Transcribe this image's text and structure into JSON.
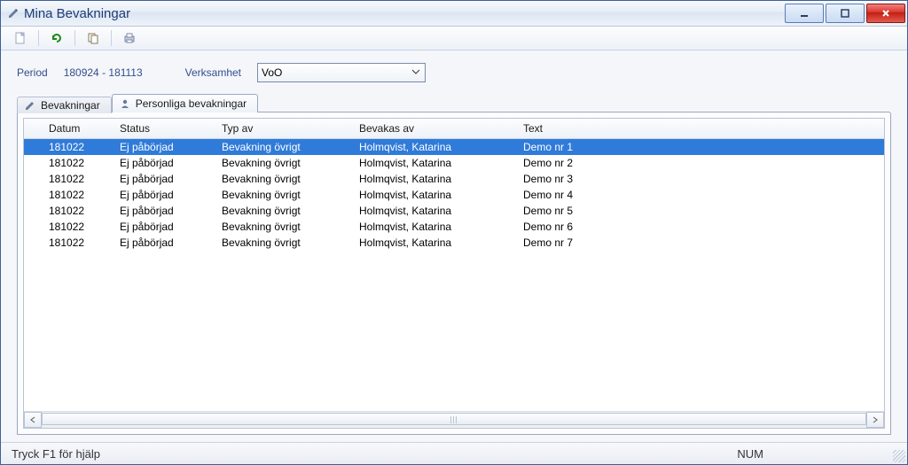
{
  "window": {
    "title": "Mina Bevakningar"
  },
  "filters": {
    "period_label": "Period",
    "period_value": "180924 - 181113",
    "verksamhet_label": "Verksamhet",
    "verksamhet_value": "VoO"
  },
  "tabs": {
    "bevakningar": "Bevakningar",
    "personliga": "Personliga bevakningar"
  },
  "columns": {
    "datum": "Datum",
    "status": "Status",
    "typ": "Typ av",
    "bevakas": "Bevakas av",
    "text": "Text"
  },
  "rows": [
    {
      "datum": "181022",
      "status": "Ej påbörjad",
      "typ": "Bevakning övrigt",
      "bevakas": "Holmqvist, Katarina",
      "text": "Demo nr 1",
      "selected": true
    },
    {
      "datum": "181022",
      "status": "Ej påbörjad",
      "typ": "Bevakning övrigt",
      "bevakas": "Holmqvist, Katarina",
      "text": "Demo nr 2",
      "selected": false
    },
    {
      "datum": "181022",
      "status": "Ej påbörjad",
      "typ": "Bevakning övrigt",
      "bevakas": "Holmqvist, Katarina",
      "text": "Demo nr 3",
      "selected": false
    },
    {
      "datum": "181022",
      "status": "Ej påbörjad",
      "typ": "Bevakning övrigt",
      "bevakas": "Holmqvist, Katarina",
      "text": "Demo nr 4",
      "selected": false
    },
    {
      "datum": "181022",
      "status": "Ej påbörjad",
      "typ": "Bevakning övrigt",
      "bevakas": "Holmqvist, Katarina",
      "text": "Demo nr 5",
      "selected": false
    },
    {
      "datum": "181022",
      "status": "Ej påbörjad",
      "typ": "Bevakning övrigt",
      "bevakas": "Holmqvist, Katarina",
      "text": "Demo nr 6",
      "selected": false
    },
    {
      "datum": "181022",
      "status": "Ej påbörjad",
      "typ": "Bevakning övrigt",
      "bevakas": "Holmqvist, Katarina",
      "text": "Demo nr 7",
      "selected": false
    }
  ],
  "status": {
    "help": "Tryck F1 för hjälp",
    "num": "NUM"
  }
}
